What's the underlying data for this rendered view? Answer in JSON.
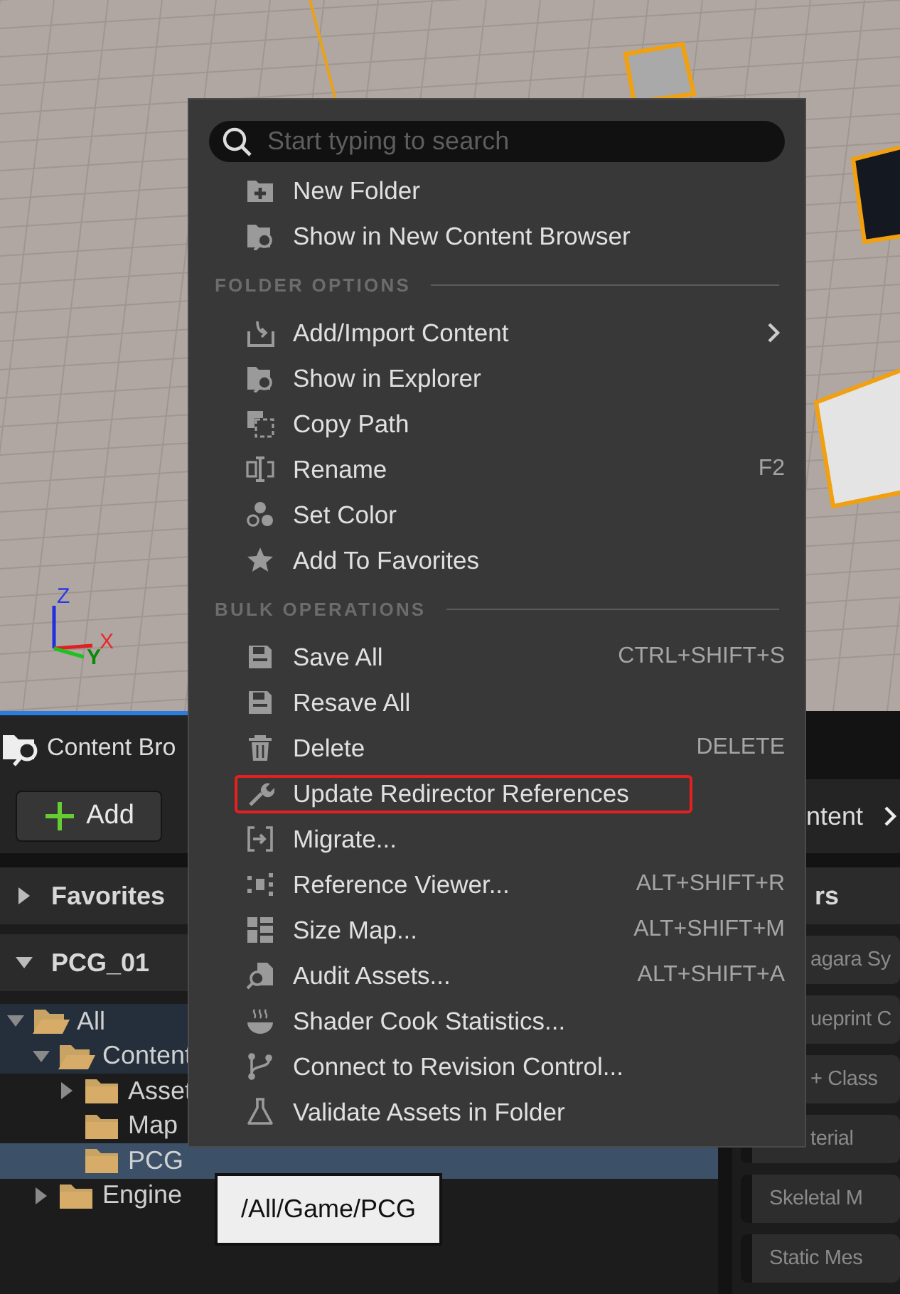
{
  "viewport": {
    "axis_labels": [
      "Z",
      "X",
      "Y"
    ]
  },
  "content_browser": {
    "tab": {
      "title": "Content Bro"
    },
    "add_button": {
      "label": "Add"
    },
    "breadcrumb": {
      "text": "ntent"
    },
    "sections": [
      {
        "title": "Favorites",
        "expanded": false
      },
      {
        "title": "PCG_01",
        "expanded": true
      }
    ],
    "tree": [
      {
        "label": "All",
        "expanded": true,
        "selected": false,
        "children": [
          {
            "label": "Content",
            "expanded": true,
            "selected": false,
            "children": [
              {
                "label": "Asset",
                "expanded": false,
                "selected": false
              },
              {
                "label": "Map",
                "selected": false
              },
              {
                "label": "PCG",
                "selected": true
              }
            ]
          },
          {
            "label": "Engine",
            "expanded": false,
            "selected": false
          }
        ]
      }
    ],
    "filters_header": {
      "text": "rs"
    },
    "filters": [
      {
        "label": "agara Sy",
        "covered": true
      },
      {
        "label": "ueprint C",
        "covered": true
      },
      {
        "label": "+ Class",
        "covered": true
      },
      {
        "label": "terial",
        "covered": true
      },
      {
        "label": "Skeletal M",
        "covered": false
      },
      {
        "label": "Static Mes",
        "covered": false
      }
    ]
  },
  "context_menu": {
    "search": {
      "placeholder": "Start typing to search"
    },
    "entries": [
      {
        "kind": "item",
        "label": "New Folder",
        "submenu": false,
        "highlighted": false
      },
      {
        "kind": "item",
        "label": "Show in New Content Browser",
        "submenu": false,
        "highlighted": false
      },
      {
        "kind": "header",
        "label": "FOLDER OPTIONS"
      },
      {
        "kind": "item",
        "label": "Add/Import Content",
        "submenu": true,
        "highlighted": false
      },
      {
        "kind": "item",
        "label": "Show in Explorer",
        "submenu": false,
        "highlighted": false
      },
      {
        "kind": "item",
        "label": "Copy Path",
        "submenu": false,
        "highlighted": false
      },
      {
        "kind": "item",
        "label": "Rename",
        "shortcut": "F2",
        "submenu": false,
        "highlighted": false
      },
      {
        "kind": "item",
        "label": "Set Color",
        "submenu": false,
        "highlighted": false
      },
      {
        "kind": "item",
        "label": "Add To Favorites",
        "submenu": false,
        "highlighted": false
      },
      {
        "kind": "header",
        "label": "BULK OPERATIONS"
      },
      {
        "kind": "item",
        "label": "Save All",
        "shortcut": "CTRL+SHIFT+S",
        "submenu": false,
        "highlighted": false
      },
      {
        "kind": "item",
        "label": "Resave All",
        "submenu": false,
        "highlighted": false
      },
      {
        "kind": "item",
        "label": "Delete",
        "shortcut": "DELETE",
        "submenu": false,
        "highlighted": false
      },
      {
        "kind": "item",
        "label": "Update Redirector References",
        "submenu": false,
        "highlighted": true
      },
      {
        "kind": "item",
        "label": "Migrate...",
        "submenu": false,
        "highlighted": false
      },
      {
        "kind": "item",
        "label": "Reference Viewer...",
        "shortcut": "ALT+SHIFT+R",
        "submenu": false,
        "highlighted": false
      },
      {
        "kind": "item",
        "label": "Size Map...",
        "shortcut": "ALT+SHIFT+M",
        "submenu": false,
        "highlighted": false
      },
      {
        "kind": "item",
        "label": "Audit Assets...",
        "shortcut": "ALT+SHIFT+A",
        "submenu": false,
        "highlighted": false
      },
      {
        "kind": "item",
        "label": "Shader Cook Statistics...",
        "submenu": false,
        "highlighted": false
      },
      {
        "kind": "item",
        "label": "Connect to Revision Control...",
        "submenu": false,
        "highlighted": false
      },
      {
        "kind": "item",
        "label": "Validate Assets in Folder",
        "submenu": false,
        "highlighted": false
      }
    ]
  },
  "tooltip": {
    "text": "/All/Game/PCG"
  }
}
